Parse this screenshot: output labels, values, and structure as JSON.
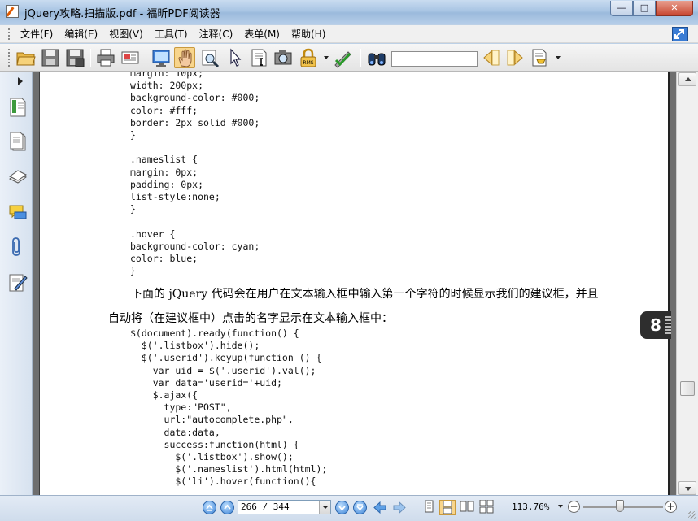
{
  "window": {
    "title": "jQuery攻略.扫描版.pdf - 福昕PDF阅读器",
    "minimize_glyph": "—",
    "maximize_glyph": "□",
    "close_glyph": "✕"
  },
  "menu": {
    "items": [
      {
        "label": "文件(F)"
      },
      {
        "label": "编辑(E)"
      },
      {
        "label": "视图(V)"
      },
      {
        "label": "工具(T)"
      },
      {
        "label": "注释(C)"
      },
      {
        "label": "表单(M)"
      },
      {
        "label": "帮助(H)"
      }
    ]
  },
  "toolbar": {
    "search_value": "",
    "icons": [
      "open-icon",
      "save-icon",
      "save-as-icon",
      "print-icon",
      "email-icon",
      "fullscreen-icon",
      "hand-tool-icon",
      "zoom-tool-icon",
      "select-tool-icon",
      "text-select-icon",
      "snapshot-icon",
      "rms-lock-icon",
      "sign-icon",
      "find-icon",
      "find-prev-icon",
      "find-next-icon",
      "highlight-icon"
    ],
    "rms_label": "RMS"
  },
  "left_panel": {
    "icons": [
      "bookmarks-icon",
      "pages-icon",
      "layers-icon",
      "comments-icon",
      "attachments-icon",
      "signatures-icon"
    ]
  },
  "document": {
    "code_block_1": "margin: 10px;\nwidth: 200px;\nbackground-color: #000;\ncolor: #fff;\nborder: 2px solid #000;\n}\n\n.nameslist {\nmargin: 0px;\npadding: 0px;\nlist-style:none;\n}\n\n.hover {\nbackground-color: cyan;\ncolor: blue;\n}",
    "prose_line_1": "下面的 jQuery 代码会在用户在文本输入框中输入第一个字符的时候显示我们的建议框，并且",
    "prose_line_2": "自动将（在建议框中）点击的名字显示在文本输入框中：",
    "code_block_2": "$(document).ready(function() {\n  $('.listbox').hide();\n  $('.userid').keyup(function () {\n    var uid = $('.userid').val();\n    var data='userid='+uid;\n    $.ajax({\n      type:\"POST\",\n      url:\"autocomplete.php\",\n      data:data,\n      success:function(html) {\n        $('.listbox').show();\n        $('.nameslist').html(html);\n        $('li').hover(function(){",
    "chapter_number": "8"
  },
  "status": {
    "page_display": "266 / 344",
    "zoom": "113.76%",
    "zoom_level_fraction": 0.46,
    "minus_glyph": "−",
    "plus_glyph": "+"
  },
  "colors": {
    "accent": "#3b82d6",
    "active_tool": "#f8d58c"
  }
}
